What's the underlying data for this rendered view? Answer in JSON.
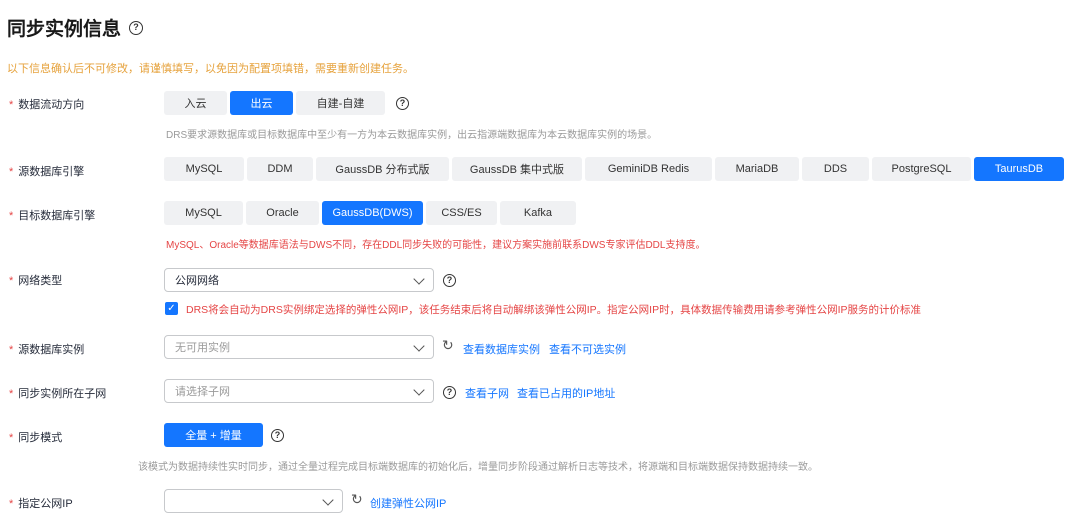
{
  "page": {
    "title": "同步实例信息",
    "help_glyph": "?",
    "notice": "以下信息确认后不可修改，请谨慎填写，以免因为配置项填错，需要重新创建任务。",
    "required_mark": "*"
  },
  "flow_direction": {
    "label": "数据流动方向",
    "options": [
      "入云",
      "出云",
      "自建-自建"
    ],
    "selected": "出云",
    "hint": "DRS要求源数据库或目标数据库中至少有一方为本云数据库实例，出云指源端数据库为本云数据库实例的场景。"
  },
  "source_engine": {
    "label": "源数据库引擎",
    "options": [
      "MySQL",
      "DDM",
      "GaussDB 分布式版",
      "GaussDB 集中式版",
      "GeminiDB Redis",
      "MariaDB",
      "DDS",
      "PostgreSQL",
      "TaurusDB"
    ],
    "selected": "TaurusDB"
  },
  "target_engine": {
    "label": "目标数据库引擎",
    "options": [
      "MySQL",
      "Oracle",
      "GaussDB(DWS)",
      "CSS/ES",
      "Kafka"
    ],
    "selected": "GaussDB(DWS)",
    "warning": "MySQL、Oracle等数据库语法与DWS不同，存在DDL同步失败的可能性，建议方案实施前联系DWS专家评估DDL支持度。"
  },
  "network_type": {
    "label": "网络类型",
    "value": "公网网络",
    "checkbox_checked": true,
    "checkbox_text": "DRS将会自动为DRS实例绑定选择的弹性公网IP，该任务结束后将自动解绑该弹性公网IP。指定公网IP时，具体数据传输费用请参考弹性公网IP服务的计价标准"
  },
  "source_instance": {
    "label": "源数据库实例",
    "placeholder": "无可用实例",
    "links": [
      "查看数据库实例",
      "查看不可选实例"
    ]
  },
  "subnet": {
    "label": "同步实例所在子网",
    "placeholder": "请选择子网",
    "links": [
      "查看子网",
      "查看已占用的IP地址"
    ]
  },
  "sync_mode": {
    "label": "同步模式",
    "button": "全量 + 增量",
    "hint": "该模式为数据持续性实时同步，通过全量过程完成目标端数据库的初始化后，增量同步阶段通过解析日志等技术，将源端和目标端数据保持数据持续一致。"
  },
  "public_ip": {
    "label": "指定公网IP",
    "value": "",
    "link": "创建弹性公网IP"
  },
  "icons": {
    "refresh": "refresh-icon",
    "help": "help-circle-icon",
    "chevron": "chevron-down-icon",
    "check": "check-icon"
  },
  "colors": {
    "primary": "#1476ff",
    "warning": "#e6a23c",
    "error": "#e54545"
  }
}
